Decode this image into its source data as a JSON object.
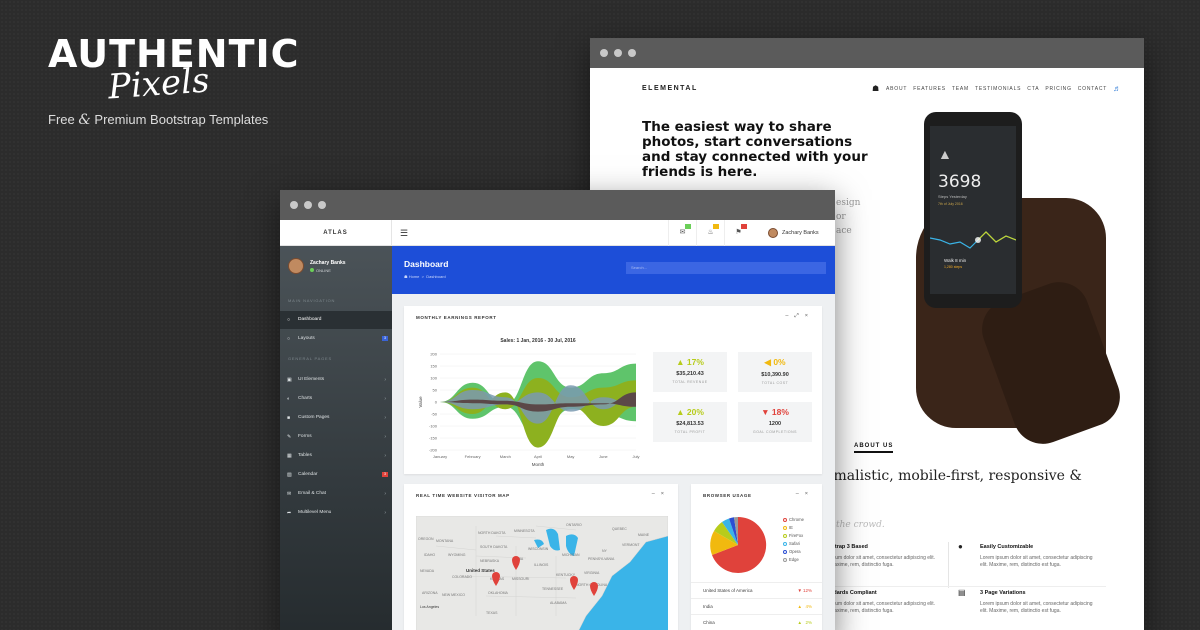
{
  "brand": {
    "line1": "AUTHENTIC",
    "line2": "Pixels",
    "tag_pre": "Free ",
    "tag_amp": "&",
    "tag_post": " Premium Bootstrap Templates"
  },
  "elemental": {
    "logo": "ELEMENTAL",
    "menu": [
      "ABOUT",
      "FEATURES",
      "TEAM",
      "TESTIMONIALS",
      "CTA",
      "PRICING",
      "CONTACT"
    ],
    "hero": "The easiest way to share photos, start conversations and stay connected with your friends is here.",
    "ghost": [
      "esign",
      "or",
      "ace"
    ],
    "phone": {
      "steps": "3698",
      "label": "Steps Yesterday",
      "date": "7th of July 2016",
      "walk": "Walk 8 min",
      "walk_sub": "1,280 steps"
    },
    "about": "ABOUT US",
    "mini": "nimalistic, mobile-first, responsive &",
    "crowd": "the crowd.",
    "features": [
      {
        "title": "tstrap 3 Based",
        "text": "psum dolor sit amet, consectetur adipiscing elit. Maxime, rem, distinctio fuga.",
        "icon": "cube-icon"
      },
      {
        "title": "Easily Customizable",
        "text": "Lorem ipsum dolor sit amet, consectetur adipiscing elit. Maxime, rem, distinctio est fuga.",
        "icon": "drop-icon"
      },
      {
        "title": "ndards Compliant",
        "text": "psum dolor sit amet, consectetur adipiscing elit. Maxime, rem, distinctio fuga.",
        "icon": "check-icon"
      },
      {
        "title": "3 Page Variations",
        "text": "Lorem ipsum dolor sit amet, consectetur adipiscing elit. Maxime, rem, distinctio est fuga.",
        "icon": "layers-icon"
      }
    ]
  },
  "atlas": {
    "brand": "ATLAS",
    "user": "Zachary Banks",
    "status": "ONLINE",
    "sections": {
      "main": "MAIN NAVIGATION",
      "general": "GENERAL PAGES"
    },
    "nav": [
      {
        "label": "Dashboard",
        "active": true
      },
      {
        "label": "Layouts",
        "badge": "3",
        "badge_color": "#3a63d6"
      },
      {
        "label": "UI Elements"
      },
      {
        "label": "Charts"
      },
      {
        "label": "Custom Pages"
      },
      {
        "label": "Forms"
      },
      {
        "label": "Tables"
      },
      {
        "label": "Calendar",
        "badge": "3",
        "badge_color": "#e0423b"
      },
      {
        "label": "Email & Chat"
      },
      {
        "label": "Multilevel Menu"
      }
    ],
    "header": {
      "title": "Dashboard",
      "crumb_home": "Home",
      "crumb_sep": ">",
      "crumb_cur": "Dashboard",
      "search_placeholder": "Search..."
    },
    "earnings": {
      "title": "MONTHLY EARNINGS REPORT",
      "stats": [
        {
          "pct": "17%",
          "dir": "up",
          "color": "#b7cc1b",
          "value": "$35,210.43",
          "label": "TOTAL REVENUE"
        },
        {
          "pct": "0%",
          "dir": "flat",
          "color": "#f1b90f",
          "value": "$10,390.90",
          "label": "TOTAL COST"
        },
        {
          "pct": "20%",
          "dir": "up",
          "color": "#b7cc1b",
          "value": "$24,813.53",
          "label": "TOTAL PROFIT"
        },
        {
          "pct": "18%",
          "dir": "down",
          "color": "#e0423b",
          "value": "1200",
          "label": "GOAL COMPLETIONS"
        }
      ]
    },
    "map": {
      "title": "REAL TIME WEBSITE VISITOR MAP",
      "labels": [
        "MONTANA",
        "NORTH DAKOTA",
        "MINNESOTA",
        "ONTARIO",
        "QUEBEC",
        "SOUTH DAKOTA",
        "WISCONSIN",
        "MICHIGAN",
        "VERMONT",
        "WYOMING",
        "NEBRASKA",
        "IOWA",
        "ILLINOIS",
        "PENNSYLVANIA",
        "United States",
        "COLORADO",
        "KANSAS",
        "MISSOURI",
        "KENTUCKY",
        "VIRGINIA",
        "NEW MEXICO",
        "OKLAHOMA",
        "TENNESSEE",
        "NORTH CAROLINA",
        "ARIZONA",
        "Los Angeles",
        "TEXAS",
        "ALABAMA",
        "OREGON",
        "IDAHO",
        "NEVADA",
        "MAINE",
        "NY"
      ]
    },
    "browser": {
      "title": "BROWSER USAGE",
      "legend": [
        {
          "name": "Chrome",
          "color": "#e0423b"
        },
        {
          "name": "IE",
          "color": "#f1b90f"
        },
        {
          "name": "FireFox",
          "color": "#b7cc1b"
        },
        {
          "name": "Safari",
          "color": "#3ab4e8"
        },
        {
          "name": "Opera",
          "color": "#2b4ed3"
        },
        {
          "name": "Edge",
          "color": "#999999"
        }
      ],
      "countries": [
        {
          "name": "United States of America",
          "change": "12%",
          "dir": "down",
          "color": "#e0423b"
        },
        {
          "name": "India",
          "change": "4%",
          "dir": "up",
          "color": "#f1b90f"
        },
        {
          "name": "China",
          "change": "2%",
          "dir": "up",
          "color": "#b7cc1b"
        }
      ]
    }
  },
  "chart_data": {
    "type": "area",
    "title": "Sales: 1 Jan, 2016 - 30 Jul, 2016",
    "xlabel": "Month",
    "ylabel": "Value",
    "categories": [
      "January",
      "February",
      "March",
      "April",
      "May",
      "June",
      "July"
    ],
    "ylim": [
      -200,
      200
    ],
    "yticks": [
      200,
      150,
      100,
      50,
      0,
      -50,
      -100,
      -150,
      -200
    ],
    "series": [
      {
        "values": [
          0,
          80,
          -10,
          170,
          60,
          120,
          160
        ],
        "neg": [
          0,
          -70,
          -20,
          -150,
          -30,
          -50,
          -80
        ],
        "color": "#5fc46b"
      },
      {
        "values": [
          0,
          -50,
          40,
          -190,
          -20,
          -100,
          -20
        ],
        "neg": [
          0,
          60,
          -30,
          100,
          20,
          60,
          90
        ],
        "color": "#8db11f"
      },
      {
        "values": [
          0,
          50,
          20,
          -90,
          70,
          -30,
          40
        ],
        "neg": [
          0,
          -30,
          -10,
          40,
          -40,
          20,
          -20
        ],
        "color": "#7a9ab0"
      },
      {
        "values": [
          0,
          -5,
          -10,
          -40,
          -20,
          -10,
          40
        ],
        "neg": [
          0,
          10,
          5,
          -10,
          -5,
          -5,
          -20
        ],
        "color": "#5b4848"
      }
    ]
  }
}
